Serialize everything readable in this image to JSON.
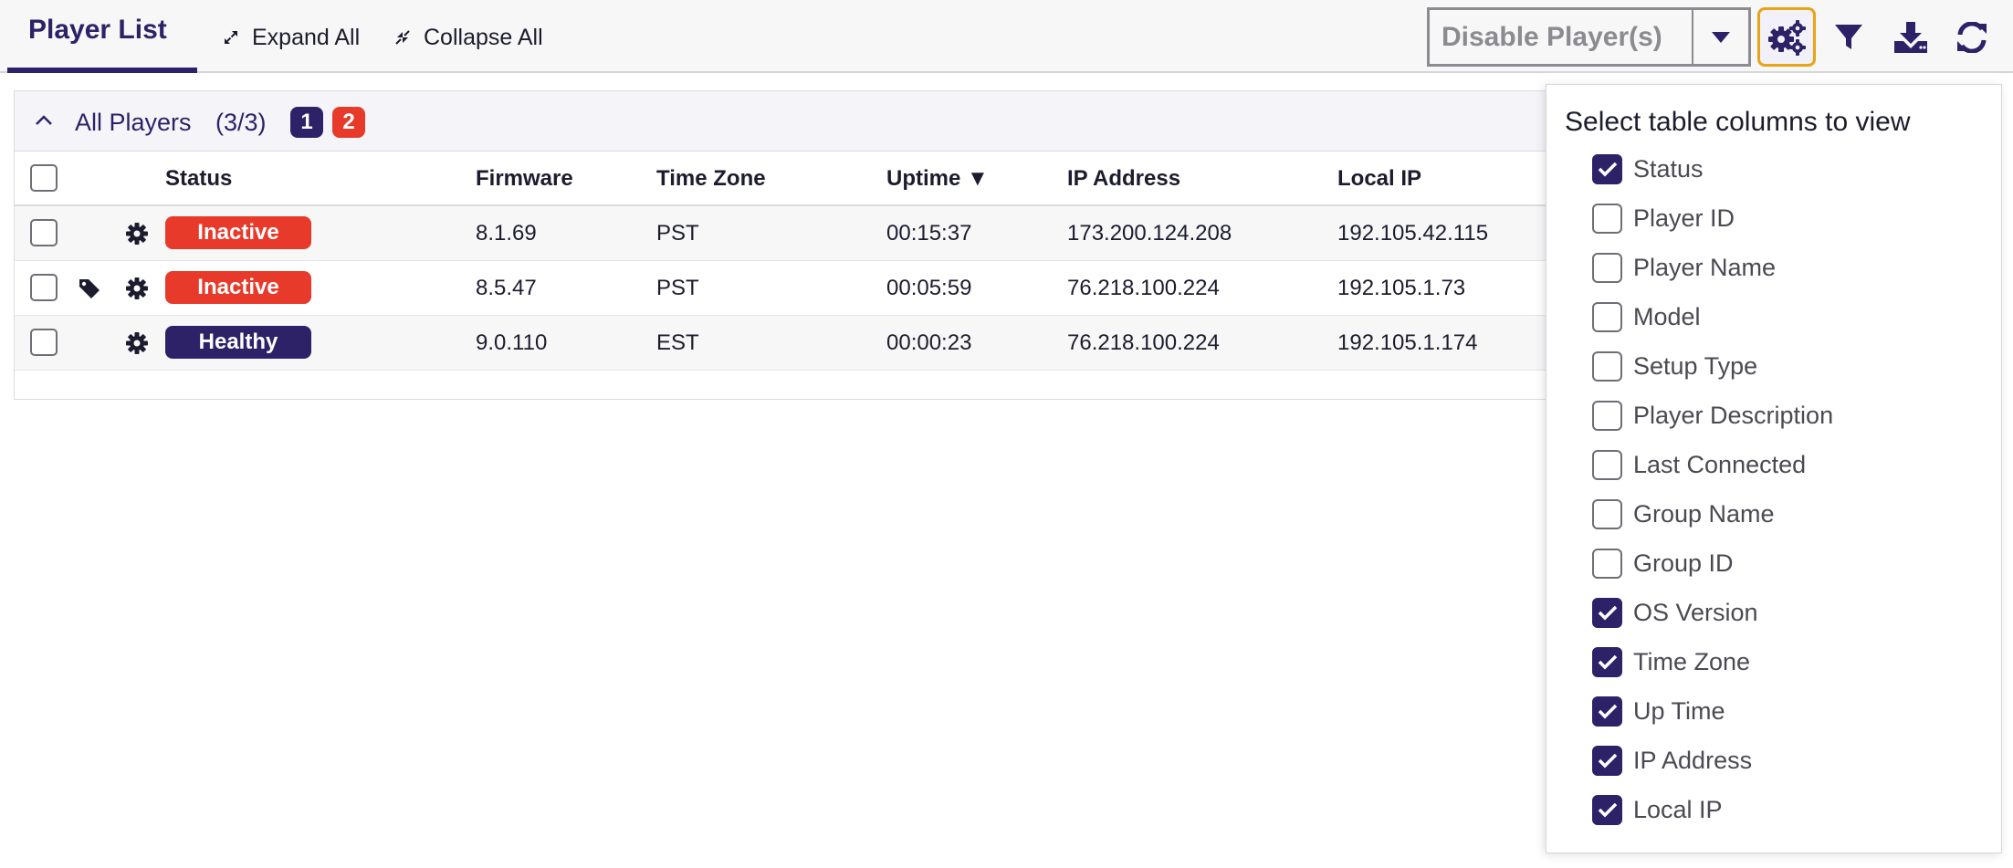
{
  "toolbar": {
    "tab_label": "Player List",
    "expand_all": "Expand All",
    "collapse_all": "Collapse All",
    "action_select": "Disable Player(s)",
    "icons": [
      "cogs-icon",
      "filter-icon",
      "download-icon",
      "refresh-icon"
    ]
  },
  "group": {
    "title": "All Players",
    "count": "(3/3)",
    "badge_primary": "1",
    "badge_alert": "2"
  },
  "table": {
    "headers": {
      "status": "Status",
      "firmware": "Firmware",
      "timezone": "Time Zone",
      "uptime": "Uptime ▼",
      "ip": "IP Address",
      "local_ip": "Local IP"
    },
    "rows": [
      {
        "status": "Inactive",
        "firmware": "8.1.69",
        "timezone": "PST",
        "uptime": "00:15:37",
        "ip": "173.200.124.208",
        "local_ip": "192.105.42.115",
        "tagged": false
      },
      {
        "status": "Inactive",
        "firmware": "8.5.47",
        "timezone": "PST",
        "uptime": "00:05:59",
        "ip": "76.218.100.224",
        "local_ip": "192.105.1.73",
        "tagged": true
      },
      {
        "status": "Healthy",
        "firmware": "9.0.110",
        "timezone": "EST",
        "uptime": "00:00:23",
        "ip": "76.218.100.224",
        "local_ip": "192.105.1.174",
        "tagged": false
      }
    ]
  },
  "columns_popup": {
    "title": "Select table columns to view",
    "options": [
      {
        "label": "Status",
        "checked": true
      },
      {
        "label": "Player ID",
        "checked": false
      },
      {
        "label": "Player Name",
        "checked": false
      },
      {
        "label": "Model",
        "checked": false
      },
      {
        "label": "Setup Type",
        "checked": false
      },
      {
        "label": "Player Description",
        "checked": false
      },
      {
        "label": "Last Connected",
        "checked": false
      },
      {
        "label": "Group Name",
        "checked": false
      },
      {
        "label": "Group ID",
        "checked": false
      },
      {
        "label": "OS Version",
        "checked": true
      },
      {
        "label": "Time Zone",
        "checked": true
      },
      {
        "label": "Up Time",
        "checked": true
      },
      {
        "label": "IP Address",
        "checked": true
      },
      {
        "label": "Local IP",
        "checked": true
      }
    ]
  },
  "colors": {
    "brand": "#2d2267",
    "alert": "#e83a2a",
    "focus": "#e8a317"
  }
}
